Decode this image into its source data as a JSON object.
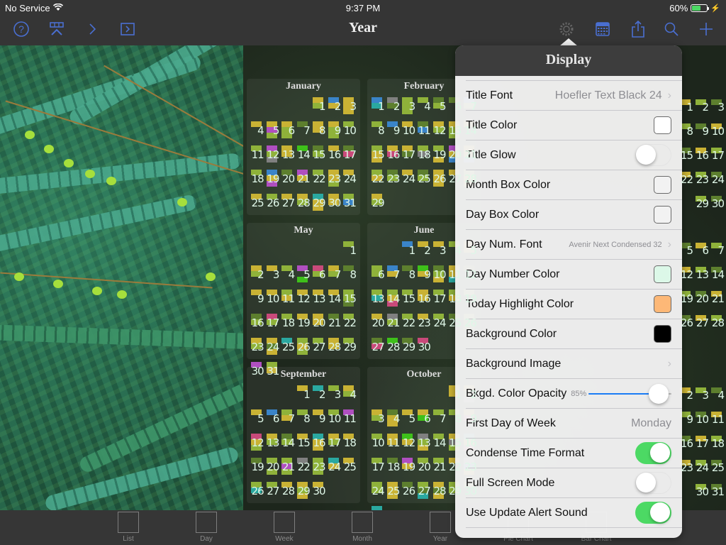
{
  "status_bar": {
    "carrier": "No Service",
    "time": "9:37 PM",
    "battery": "60%",
    "battery_level": 0.6
  },
  "navbar": {
    "title": "Year",
    "left_icons": [
      "help-icon",
      "filter-icon",
      "chevron-right-icon",
      "sidebar-toggle-icon"
    ],
    "right_icons": [
      "gear-icon",
      "calendar-grid-icon",
      "share-icon",
      "search-icon",
      "add-icon"
    ],
    "accent": "#4a6fd1"
  },
  "calendar": {
    "months": [
      {
        "name": "January",
        "offset": 4,
        "days": 31
      },
      {
        "name": "February",
        "offset": 0,
        "days": 29
      },
      {
        "name": "May",
        "offset": 6,
        "days": 31
      },
      {
        "name": "June",
        "offset": 2,
        "days": 30
      },
      {
        "name": "September",
        "offset": 3,
        "days": 30
      },
      {
        "name": "October",
        "offset": 5,
        "days": 31
      }
    ],
    "partial_right": {
      "rows": [
        [
          "1",
          "2",
          "3"
        ],
        [
          "8",
          "9",
          "10"
        ],
        [
          "15",
          "16",
          "17"
        ],
        [
          "22",
          "23",
          "24"
        ],
        [
          "29",
          "30"
        ],
        [
          "5",
          "6",
          "7"
        ],
        [
          "12",
          "13",
          "14"
        ],
        [
          "19",
          "20",
          "21"
        ],
        [
          "26",
          "27",
          "28"
        ],
        [
          "2",
          "3",
          "4"
        ],
        [
          "9",
          "10",
          "11"
        ],
        [
          "16",
          "17",
          "18"
        ],
        [
          "23",
          "24",
          "25"
        ],
        [
          "30",
          "31"
        ]
      ]
    },
    "mark_colors": [
      "#c9b234",
      "#8fb23a",
      "#5d7f2e",
      "#c94a7a",
      "#b04fc0",
      "#808080",
      "#3a84c8",
      "#2aa8a0",
      "#3ec01a"
    ]
  },
  "popover": {
    "title": "Display",
    "rows": [
      {
        "label": "Title Font",
        "value": "Hoefler Text Black 24",
        "type": "disclosure"
      },
      {
        "label": "Title Color",
        "type": "color",
        "color": "#ffffff"
      },
      {
        "label": "Title Glow",
        "type": "toggle",
        "on": false
      },
      {
        "label": "Month Box Color",
        "type": "color",
        "color": "#f2f2f2"
      },
      {
        "label": "Day Box Color",
        "type": "color",
        "color": "#f2f2f2"
      },
      {
        "label": "Day Num. Font",
        "value": "Avenir Next Condensed 32",
        "type": "disclosure-small"
      },
      {
        "label": "Day Number Color",
        "type": "color",
        "color": "#dcf8e8"
      },
      {
        "label": "Today Highlight Color",
        "type": "color",
        "color": "#fdb877"
      },
      {
        "label": "Background Color",
        "type": "color",
        "color": "#000000"
      },
      {
        "label": "Background Image",
        "type": "disclosure",
        "value": ""
      },
      {
        "label": "Bkgd. Color Opacity",
        "type": "slider",
        "value_text": "85%",
        "value": 0.85
      },
      {
        "label": "First Day of Week",
        "type": "value",
        "value": "Monday"
      },
      {
        "label": "Condense Time Format",
        "type": "toggle",
        "on": true
      },
      {
        "label": "Full Screen Mode",
        "type": "toggle",
        "on": false
      },
      {
        "label": "Use Update Alert Sound",
        "type": "toggle",
        "on": true
      }
    ]
  },
  "tabbar": {
    "tabs": [
      {
        "label": "List",
        "icon": "list-icon"
      },
      {
        "label": "Day",
        "icon": "day-icon"
      },
      {
        "label": "Week",
        "icon": "week-icon"
      },
      {
        "label": "Month",
        "icon": "month-icon"
      },
      {
        "label": "Year",
        "icon": "year-icon"
      },
      {
        "label": "Pie Chart",
        "icon": "pie-chart-icon"
      },
      {
        "label": "Bar Chart",
        "icon": "bar-chart-icon"
      }
    ]
  }
}
